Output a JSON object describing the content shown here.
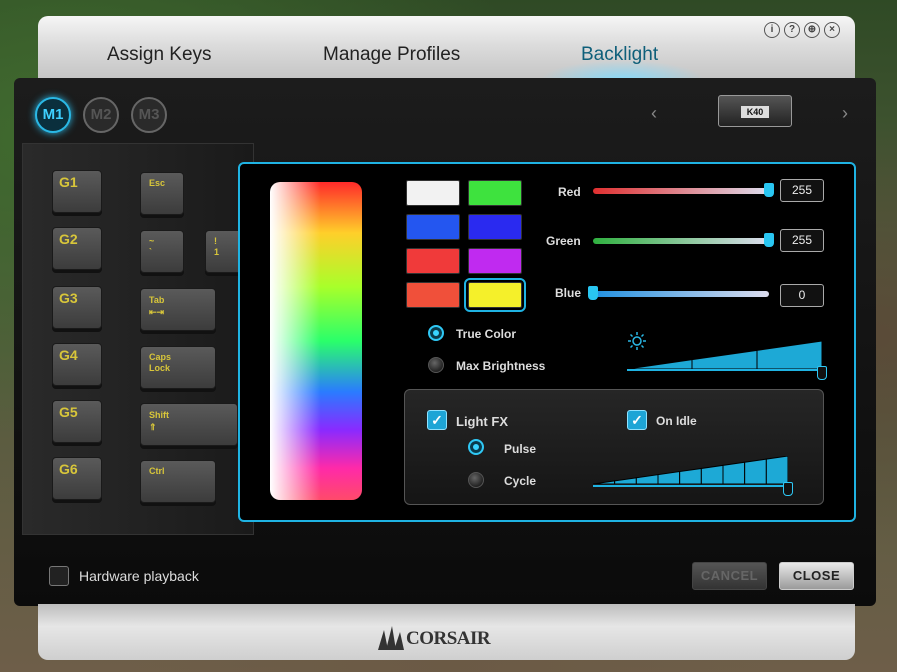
{
  "tabs": [
    {
      "label": "Assign Keys",
      "active": false
    },
    {
      "label": "Manage Profiles",
      "active": false
    },
    {
      "label": "Backlight",
      "active": true
    }
  ],
  "window_icons": [
    "info-icon",
    "help-icon",
    "globe-icon",
    "close-icon"
  ],
  "window_icon_glyphs": [
    "i",
    "?",
    "⊕",
    "×"
  ],
  "mode_buttons": [
    {
      "label": "M1",
      "active": true
    },
    {
      "label": "M2",
      "active": false
    },
    {
      "label": "M3",
      "active": false
    }
  ],
  "device": {
    "name": "K40",
    "prev_arrow": "‹",
    "next_arrow": "›"
  },
  "g_keys": [
    "G1",
    "G2",
    "G3",
    "G4",
    "G5",
    "G6"
  ],
  "keys": {
    "esc": "Esc",
    "tilde_top": "~",
    "tilde_bottom": "`",
    "one_top": "!",
    "one_bottom": "1",
    "tab": "Tab",
    "tab_arrows": "⇤⇥",
    "caps_top": "Caps",
    "caps_bottom": "Lock",
    "shift": "Shift",
    "shift_arrow": "⇑",
    "ctrl": "Ctrl"
  },
  "swatches": [
    {
      "color": "#f2f2f2"
    },
    {
      "color": "#3ee23e"
    },
    {
      "color": "#2456f0"
    },
    {
      "color": "#2a2af0"
    },
    {
      "color": "#f03a3a"
    },
    {
      "color": "#c02af0"
    },
    {
      "color": "#f0503a"
    },
    {
      "color": "#f5f02a",
      "selected": true
    }
  ],
  "sliders": [
    {
      "label": "Red",
      "value": "255",
      "level": 1.0,
      "color": "#e03030"
    },
    {
      "label": "Green",
      "value": "255",
      "level": 1.0,
      "color": "#30b040"
    },
    {
      "label": "Blue",
      "value": "0",
      "level": 0.0,
      "color": "#2090e0"
    }
  ],
  "color_mode": {
    "options": [
      {
        "label": "True Color",
        "selected": true
      },
      {
        "label": "Max Brightness",
        "selected": false
      }
    ]
  },
  "brightness": {
    "icon": "sun-icon",
    "level": 1.0,
    "steps": 3
  },
  "fx": {
    "light_fx_label": "Light FX",
    "light_fx_checked": true,
    "on_idle_label": "On Idle",
    "on_idle_checked": true,
    "modes": [
      {
        "label": "Pulse",
        "selected": true
      },
      {
        "label": "Cycle",
        "selected": false
      }
    ],
    "speed_level": 1.0,
    "speed_steps": 9
  },
  "hardware_playback": {
    "label": "Hardware playback",
    "checked": false
  },
  "buttons": {
    "cancel": "CANCEL",
    "close": "CLOSE"
  },
  "brand": "CORSAIR"
}
